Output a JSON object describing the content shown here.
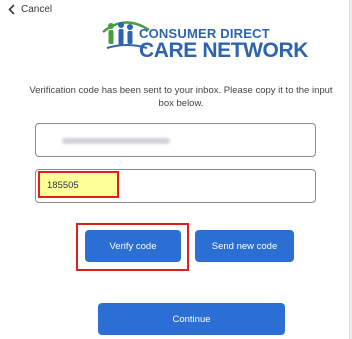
{
  "nav": {
    "cancel_label": "Cancel"
  },
  "logo": {
    "line1": "CONSUMER DIRECT",
    "line2": "CARE NETWORK"
  },
  "message": "Verification code has been sent to your inbox. Please copy it to the input box below.",
  "email_field": {
    "value": ""
  },
  "code_field": {
    "value": "185505"
  },
  "buttons": {
    "verify": "Verify code",
    "send_new": "Send new code",
    "continue": "Continue"
  },
  "colors": {
    "accent": "#2b6ed4",
    "brand": "#2e64ad",
    "highlight": "#ffff99",
    "annotation": "#e02020"
  }
}
